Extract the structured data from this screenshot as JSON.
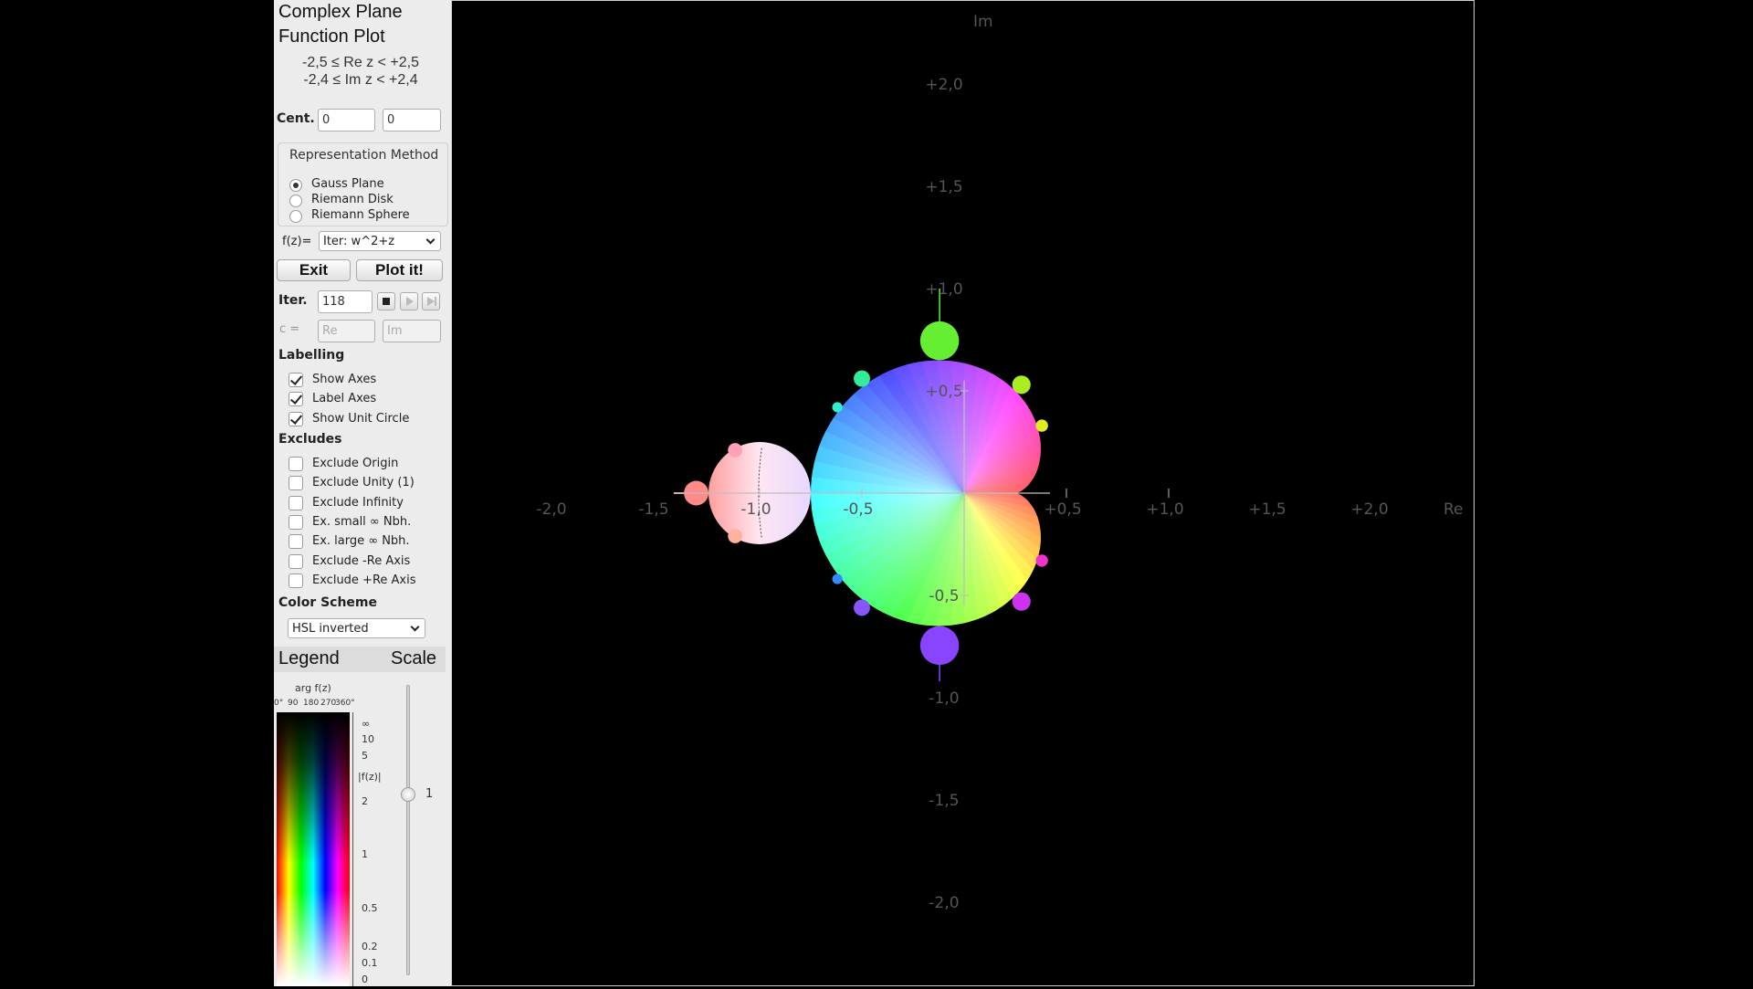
{
  "panel": {
    "title_line1": "Complex Plane",
    "title_line2": "Function Plot",
    "range_re": "-2,5 ≤ Re z < +2,5",
    "range_im": "-2,4 ≤ Im z < +2,4",
    "center_label": "Cent.",
    "center_re_value": "0",
    "center_im_value": "0",
    "representation": {
      "title": "Representation Method",
      "options": [
        "Gauss Plane",
        "Riemann Disk",
        "Riemann Sphere"
      ],
      "selected": "Gauss Plane"
    },
    "function_label": "f(z)=",
    "function_value": "Iter: w^2+z",
    "exit_label": "Exit",
    "plot_label": "Plot it!",
    "iter_label": "Iter.",
    "iter_value": "118",
    "c_label": "c =",
    "c_re_placeholder": "Re",
    "c_im_placeholder": "Im",
    "labelling_title": "Labelling",
    "labelling": [
      {
        "label": "Show Axes",
        "checked": true
      },
      {
        "label": "Label Axes",
        "checked": true
      },
      {
        "label": "Show Unit Circle",
        "checked": true
      }
    ],
    "excludes_title": "Excludes",
    "excludes": [
      {
        "label": "Exclude Origin",
        "checked": false
      },
      {
        "label": "Exclude Unity (1)",
        "checked": false
      },
      {
        "label": "Exclude Infinity",
        "checked": false
      },
      {
        "label": "Ex. small ∞ Nbh.",
        "checked": false
      },
      {
        "label": "Ex. large ∞ Nbh.",
        "checked": false
      },
      {
        "label": "Exclude -Re Axis",
        "checked": false
      },
      {
        "label": "Exclude +Re Axis",
        "checked": false
      }
    ],
    "color_scheme_title": "Color Scheme",
    "color_scheme_value": "HSL inverted",
    "legend_label": "Legend",
    "scale_label": "Scale",
    "legend": {
      "arg_label": "arg f(z)",
      "arg_ticks": [
        "0°",
        "90",
        "180",
        "270",
        "360°"
      ],
      "mod_label": "|f(z)|",
      "mod_ticks": [
        "∞",
        "10",
        "5",
        "2",
        "1",
        "0.5",
        "0.2",
        "0.1",
        "0"
      ]
    },
    "scale_value": "1"
  },
  "plot": {
    "axis_re_label": "Re",
    "axis_im_label": "Im",
    "x_ticks": [
      "-2,0",
      "-1,5",
      "-1,0",
      "-0,5",
      "+0,5",
      "+1,0",
      "+1,5",
      "+2,0"
    ],
    "y_ticks": [
      "+2,0",
      "+1,5",
      "+1,0",
      "+0,5",
      "-0,5",
      "-1,0",
      "-1,5",
      "-2,0"
    ],
    "x_tick_values": [
      -2.0,
      -1.5,
      -1.0,
      -0.5,
      0.5,
      1.0,
      1.5,
      2.0
    ],
    "y_tick_values": [
      2.0,
      1.5,
      1.0,
      0.5,
      -0.5,
      -1.0,
      -1.5,
      -2.0
    ]
  },
  "colors": {
    "panel_bg": "#ececec",
    "plot_bg": "#000000",
    "axis": "#bfbfbf",
    "tick_text": "#555555"
  }
}
